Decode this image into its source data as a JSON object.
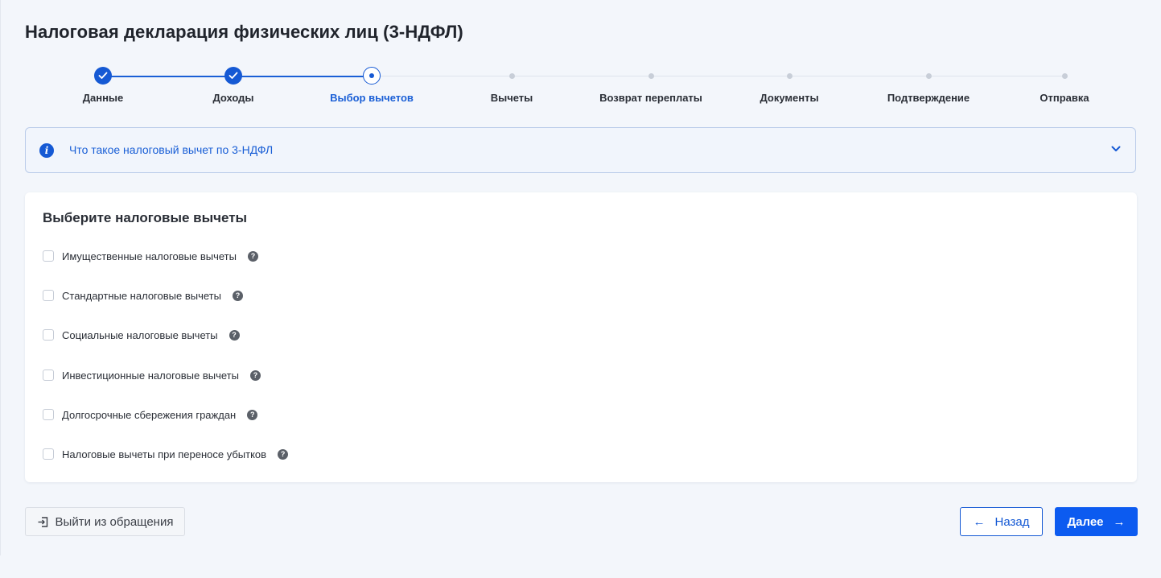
{
  "page": {
    "title": "Налоговая декларация физических лиц (3-НДФЛ)"
  },
  "stepper": {
    "steps": [
      {
        "label": "Данные",
        "state": "done"
      },
      {
        "label": "Доходы",
        "state": "done"
      },
      {
        "label": "Выбор вычетов",
        "state": "current"
      },
      {
        "label": "Вычеты",
        "state": "todo"
      },
      {
        "label": "Возврат переплаты",
        "state": "todo"
      },
      {
        "label": "Документы",
        "state": "todo"
      },
      {
        "label": "Подтверждение",
        "state": "todo"
      },
      {
        "label": "Отправка",
        "state": "todo"
      }
    ]
  },
  "info_panel": {
    "text": "Что такое налоговый вычет по 3-НДФЛ",
    "icon": "info-icon",
    "expanded": false
  },
  "deductions": {
    "title": "Выберите налоговые вычеты",
    "options": [
      {
        "label": "Имущественные налоговые вычеты",
        "checked": false
      },
      {
        "label": "Стандартные налоговые вычеты",
        "checked": false
      },
      {
        "label": "Социальные налоговые вычеты",
        "checked": false
      },
      {
        "label": "Инвестиционные налоговые вычеты",
        "checked": false
      },
      {
        "label": "Долгосрочные сбережения граждан",
        "checked": false
      },
      {
        "label": "Налоговые вычеты при переносе убытков",
        "checked": false
      }
    ],
    "help_glyph": "?"
  },
  "footer": {
    "exit_label": "Выйти из обращения",
    "back_label": "Назад",
    "next_label": "Далее",
    "back_arrow": "←",
    "next_arrow": "→"
  },
  "colors": {
    "accent": "#1559d4",
    "primary_button": "#0c5bf0",
    "background": "#f3f6fb",
    "info_background": "#f1f5fc"
  }
}
